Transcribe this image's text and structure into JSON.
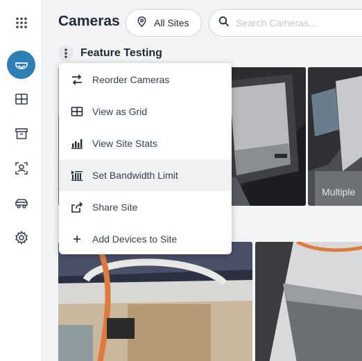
{
  "sidebar": {
    "items": [
      {
        "name": "apps-grid-icon"
      },
      {
        "name": "camera-dome-icon",
        "active": true
      },
      {
        "name": "grid-view-icon"
      },
      {
        "name": "archive-icon"
      },
      {
        "name": "face-scan-icon"
      },
      {
        "name": "vehicle-icon"
      },
      {
        "name": "settings-gear-icon"
      }
    ]
  },
  "header": {
    "title": "Cameras",
    "site_selector": "All Sites",
    "search_placeholder": "Search Cameras..."
  },
  "group": {
    "title": "Feature Testing"
  },
  "thumbnails": {
    "multiple_label": "Multiple"
  },
  "menu": {
    "items": [
      {
        "label": "Reorder Cameras",
        "icon": "reorder-arrows-icon"
      },
      {
        "label": "View as Grid",
        "icon": "grid-icon"
      },
      {
        "label": "View Site Stats",
        "icon": "bar-chart-icon"
      },
      {
        "label": "Set Bandwidth Limit",
        "icon": "bandwidth-icon"
      },
      {
        "label": "Share Site",
        "icon": "share-icon"
      },
      {
        "label": "Add Devices to Site",
        "icon": "plus-icon"
      }
    ]
  },
  "colors": {
    "active_nav": "#2e7fb8",
    "menu_hover": "#f0f1f3"
  }
}
